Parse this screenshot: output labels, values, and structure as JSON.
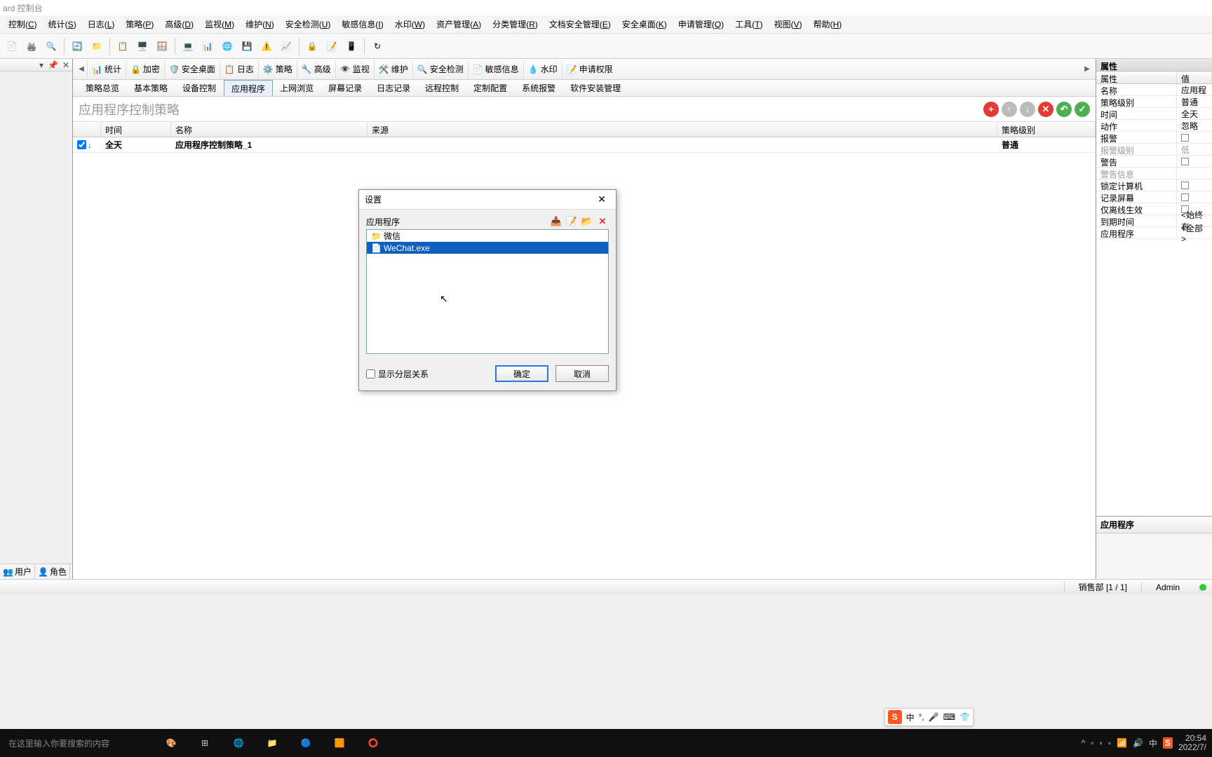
{
  "window": {
    "title": "ard 控制台"
  },
  "menu": {
    "items": [
      {
        "label": "控制",
        "mnemonic": "C"
      },
      {
        "label": "统计",
        "mnemonic": "S"
      },
      {
        "label": "日志",
        "mnemonic": "L"
      },
      {
        "label": "策略",
        "mnemonic": "P"
      },
      {
        "label": "高级",
        "mnemonic": "D"
      },
      {
        "label": "监视",
        "mnemonic": "M"
      },
      {
        "label": "维护",
        "mnemonic": "N"
      },
      {
        "label": "安全检测",
        "mnemonic": "U"
      },
      {
        "label": "敏感信息",
        "mnemonic": "I"
      },
      {
        "label": "水印",
        "mnemonic": "W"
      },
      {
        "label": "资产管理",
        "mnemonic": "A"
      },
      {
        "label": "分类管理",
        "mnemonic": "R"
      },
      {
        "label": "文档安全管理",
        "mnemonic": "E"
      },
      {
        "label": "安全桌面",
        "mnemonic": "K"
      },
      {
        "label": "申请管理",
        "mnemonic": "Q"
      },
      {
        "label": "工具",
        "mnemonic": "T"
      },
      {
        "label": "视图",
        "mnemonic": "V"
      },
      {
        "label": "帮助",
        "mnemonic": "H"
      }
    ]
  },
  "left_tabs": {
    "user": "用户",
    "role": "角色"
  },
  "sub_toolbar": {
    "items": [
      "统计",
      "加密",
      "安全桌面",
      "日志",
      "策略",
      "高级",
      "监视",
      "维护",
      "安全检测",
      "敏感信息",
      "水印",
      "申请权限"
    ]
  },
  "tabs": {
    "items": [
      "策略总览",
      "基本策略",
      "设备控制",
      "应用程序",
      "上网浏览",
      "屏幕记录",
      "日志记录",
      "远程控制",
      "定制配置",
      "系统报警",
      "软件安装管理"
    ],
    "active_index": 3
  },
  "policy": {
    "title": "应用程序控制策略",
    "columns": {
      "time": "时间",
      "name": "名称",
      "source": "来源",
      "level": "策略级别"
    },
    "rows": [
      {
        "checked": true,
        "time": "全天",
        "name": "应用程序控制策略_1",
        "source": "",
        "level": "普通"
      }
    ]
  },
  "properties": {
    "title": "属性",
    "header_key": "属性",
    "header_val": "值",
    "rows": [
      {
        "key": "名称",
        "val": "应用程"
      },
      {
        "key": "策略级别",
        "val": "普通"
      },
      {
        "key": "时间",
        "val": "全天"
      },
      {
        "key": "动作",
        "val": "忽略"
      },
      {
        "key": "报警",
        "val": "",
        "checkbox": true
      },
      {
        "key": "报警级别",
        "val": "低",
        "disabled": true
      },
      {
        "key": "警告",
        "val": "",
        "checkbox": true
      },
      {
        "key": "警告信息",
        "val": "",
        "disabled": true
      },
      {
        "key": "锁定计算机",
        "val": "",
        "checkbox": true
      },
      {
        "key": "记录屏幕",
        "val": "",
        "checkbox": true
      },
      {
        "key": "仅离线生效",
        "val": "",
        "checkbox": true
      },
      {
        "key": "到期时间",
        "val": "<始终有"
      },
      {
        "key": "应用程序",
        "val": "<全部>"
      }
    ],
    "bottom_title": "应用程序"
  },
  "dialog": {
    "title": "设置",
    "label": "应用程序",
    "items": [
      {
        "type": "folder",
        "name": "微信"
      },
      {
        "type": "file",
        "name": "WeChat.exe",
        "selected": true
      }
    ],
    "show_hierarchy": "显示分层关系",
    "ok": "确定",
    "cancel": "取消"
  },
  "statusbar": {
    "dept": "销售部 [1 / 1]",
    "user": "Admin"
  },
  "taskbar": {
    "search_placeholder": "在这里输入你要搜索的内容",
    "time": "20:54",
    "date": "2022/7/"
  },
  "ime": {
    "lang": "中"
  }
}
